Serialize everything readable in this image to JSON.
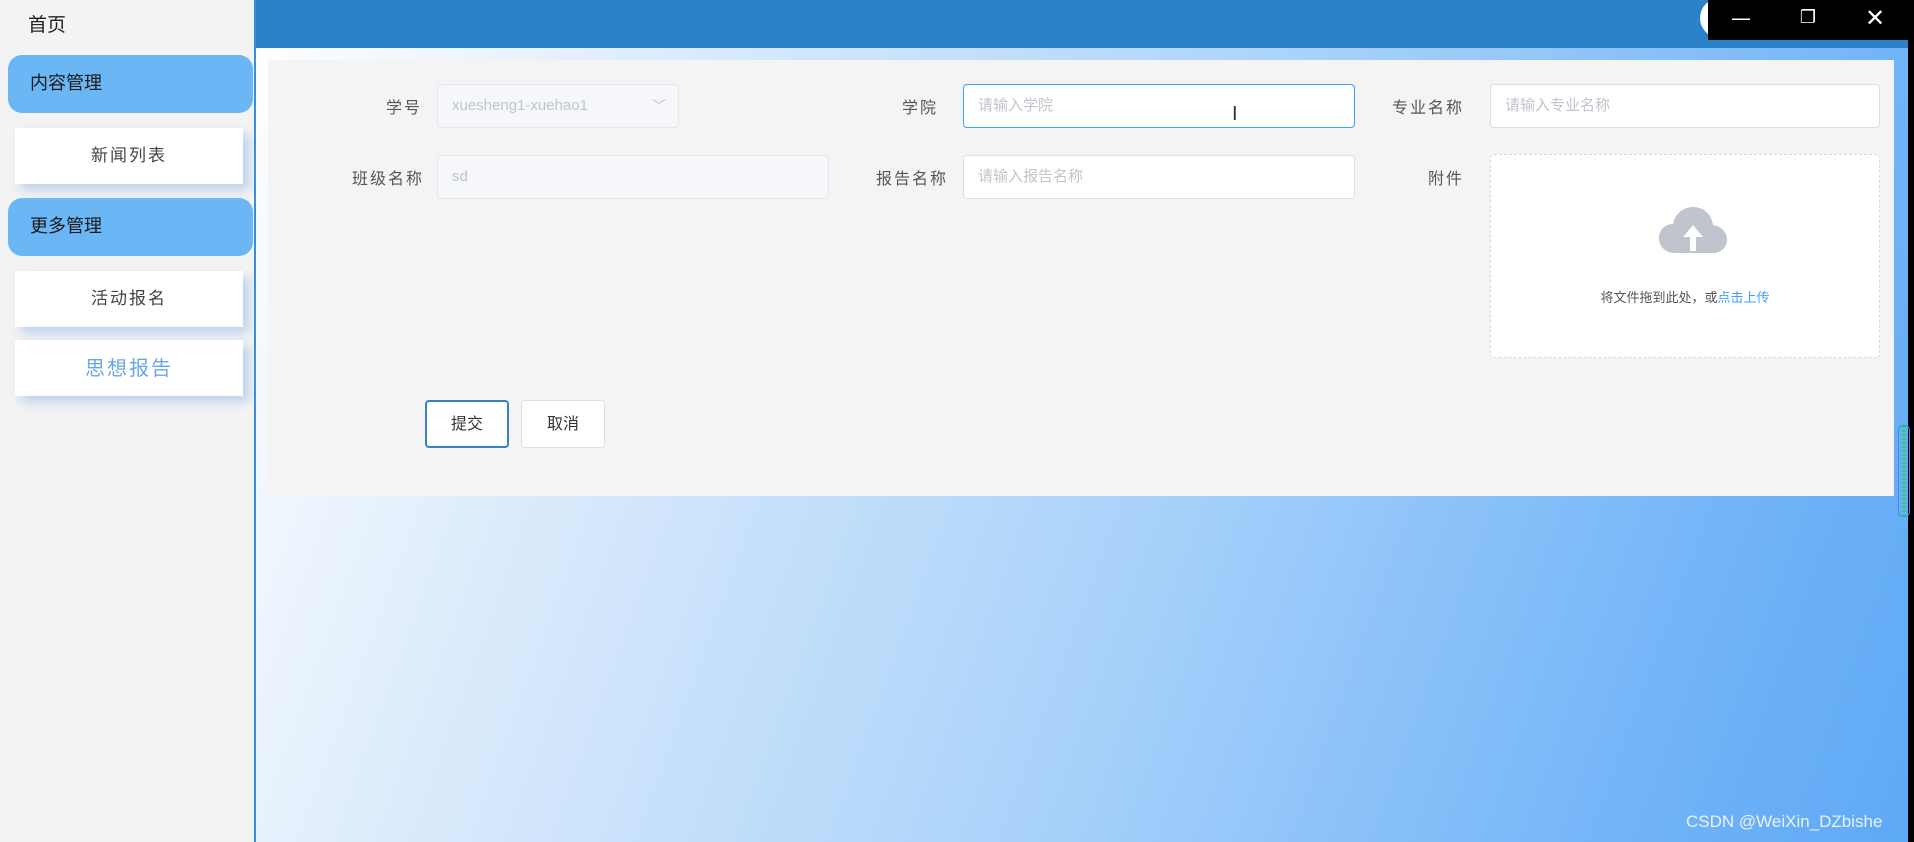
{
  "sidebar": {
    "home": "首页",
    "groups": [
      {
        "label": "内容管理",
        "items": [
          "新闻列表"
        ]
      },
      {
        "label": "更多管理",
        "items": [
          "活动报名",
          "思想报告"
        ]
      }
    ]
  },
  "window": {
    "minimize": "—",
    "maximize": "❐",
    "close": "✕"
  },
  "form": {
    "student_id": {
      "label": "学号",
      "value": "xuesheng1-xuehao1"
    },
    "college": {
      "label": "学院",
      "placeholder": "请输入学院"
    },
    "major": {
      "label": "专业名称",
      "placeholder": "请输入专业名称"
    },
    "class_name": {
      "label": "班级名称",
      "value": "sd"
    },
    "report_name": {
      "label": "报告名称",
      "placeholder": "请输入报告名称"
    },
    "attachment": {
      "label": "附件",
      "hint": "将文件拖到此处，或",
      "link": "点击上传"
    },
    "submit": "提交",
    "cancel": "取消"
  },
  "watermark": "CSDN @WeiXin_DZbishe"
}
